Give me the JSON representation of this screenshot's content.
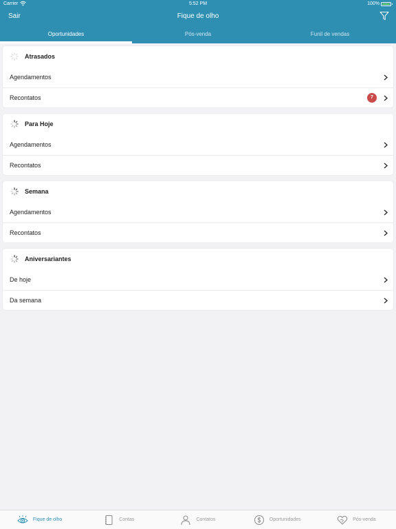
{
  "status_bar": {
    "carrier": "Carrier",
    "time": "5:52 PM",
    "battery": "100%"
  },
  "nav": {
    "left_button": "Sair",
    "title": "Fique de olho",
    "filter_icon": "filter-icon"
  },
  "top_tabs": [
    {
      "label": "Oportunidades",
      "active": true
    },
    {
      "label": "Pós-venda",
      "active": false
    },
    {
      "label": "Funil de vendas",
      "active": false
    }
  ],
  "sections": [
    {
      "title": "Atrasados",
      "rows": [
        {
          "label": "Agendamentos",
          "badge": ""
        },
        {
          "label": "Recontatos",
          "badge": "7"
        }
      ]
    },
    {
      "title": "Para Hoje",
      "rows": [
        {
          "label": "Agendamentos",
          "badge": ""
        },
        {
          "label": "Recontatos",
          "badge": ""
        }
      ]
    },
    {
      "title": "Semana",
      "rows": [
        {
          "label": "Agendamentos",
          "badge": ""
        },
        {
          "label": "Recontatos",
          "badge": ""
        }
      ]
    },
    {
      "title": "Aniversariantes",
      "rows": [
        {
          "label": "De hoje",
          "badge": ""
        },
        {
          "label": "Da semana",
          "badge": ""
        }
      ]
    }
  ],
  "bottom_tabs": [
    {
      "label": "Fique de olho",
      "icon": "eye-icon",
      "active": true
    },
    {
      "label": "Contas",
      "icon": "notebook-icon",
      "active": false
    },
    {
      "label": "Contatos",
      "icon": "person-icon",
      "active": false
    },
    {
      "label": "Oportunidades",
      "icon": "dollar-icon",
      "active": false
    },
    {
      "label": "Pós-venda",
      "icon": "heart-handshake-icon",
      "active": false
    }
  ],
  "colors": {
    "header": "#2e8fb3",
    "badge": "#c94b4b",
    "background": "#f2f2f4",
    "tab_active": "#2e8fb3"
  }
}
